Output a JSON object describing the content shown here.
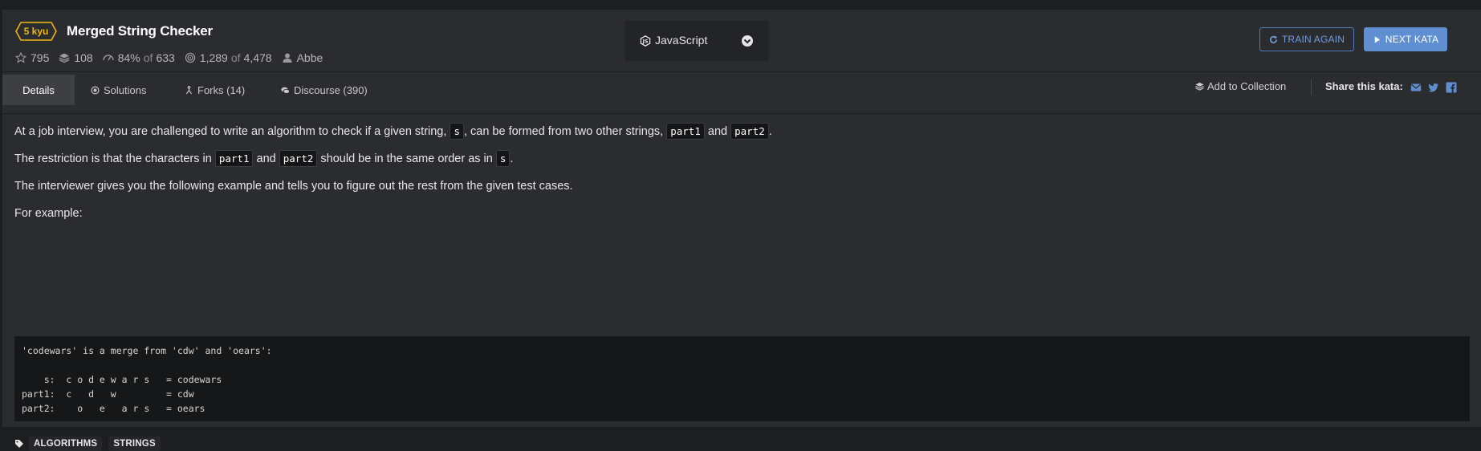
{
  "kata": {
    "rank": "5 kyu",
    "title": "Merged String Checker",
    "stats": {
      "stars": "795",
      "collections": "108",
      "satisfaction": "84%",
      "votes_of": "of",
      "votes": "633",
      "completed": "1,289",
      "completed_of": "of",
      "attempts": "4,478",
      "author": "Abbe"
    },
    "language": "JavaScript",
    "buttons": {
      "train_again": "TRAIN AGAIN",
      "next_kata": "NEXT KATA"
    }
  },
  "tabs": [
    {
      "label": "Details",
      "icon": "none"
    },
    {
      "label": "Solutions",
      "icon": "solutions-icon"
    },
    {
      "label": "Forks (14)",
      "icon": "fork-icon"
    },
    {
      "label": "Discourse (390)",
      "icon": "comments-icon"
    }
  ],
  "actions": {
    "add_to_collection": "Add to Collection",
    "share": "Share this kata:"
  },
  "description": {
    "p1": {
      "a": "At a job interview, you are challenged to write an algorithm to check if a given string,",
      "code1": "s",
      "b": ", can be formed from two other strings,",
      "code2": "part1",
      "c": "and",
      "code3": "part2",
      "d": "."
    },
    "p2": {
      "a": "The restriction is that the characters in",
      "code1": "part1",
      "b": "and",
      "code2": "part2",
      "c": "should be in the same order as in",
      "code3": "s",
      "d": "."
    },
    "p3": "The interviewer gives you the following example and tells you to figure out the rest from the given test cases.",
    "p4": "For example:",
    "code_block": "'codewars' is a merge from 'cdw' and 'oears':\n\n    s:  c o d e w a r s   = codewars\npart1:  c   d   w         = cdw\npart2:    o   e   a r s   = oears"
  },
  "tags": [
    "ALGORITHMS",
    "STRINGS"
  ],
  "colors": {
    "rank_yellow": "#ecb613",
    "accent_blue": "#5f8fd1",
    "background": "#2b2c30",
    "code_bg": "#161719"
  }
}
